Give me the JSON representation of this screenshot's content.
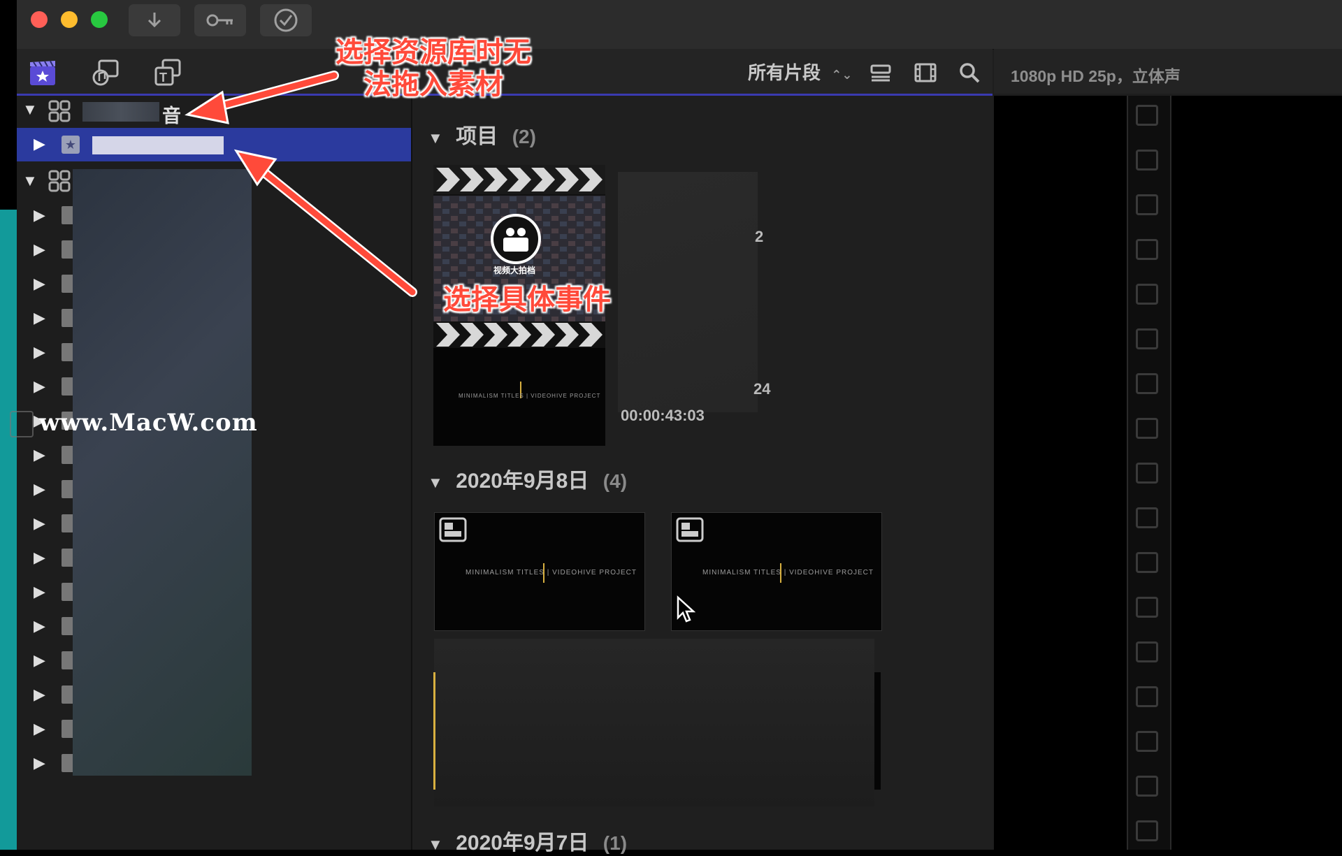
{
  "window": {
    "toolbar_buttons": [
      "download-icon",
      "key-icon",
      "checkmark-circle-icon"
    ]
  },
  "browser_toolbar": {
    "clip_filter_label": "所有片段",
    "icons": [
      "libraries-icon",
      "photos-audio-icon",
      "titles-generators-icon",
      "clip-appearance-icon",
      "filmstrip-icon",
      "search-icon"
    ]
  },
  "viewer": {
    "format_label": "1080p HD 25p，立体声"
  },
  "sidebar": {
    "library_suffix": "音",
    "event_count_visible": 17
  },
  "browser": {
    "projects_section": {
      "title": "项目",
      "count": "(2)"
    },
    "project_thumb_text": "视频大拍档",
    "project_partial_text_1": "2",
    "project_partial_text_2": "24",
    "project_timecode": "00:00:43:03",
    "minimal_title_text": "MINIMALISM TITLES | VIDEOHIVE PROJECT",
    "sections": [
      {
        "title": "2020年9月8日",
        "count": "(4)"
      },
      {
        "title": "2020年9月7日",
        "count": "(1)"
      }
    ]
  },
  "annotations": {
    "library_note_line1": "选择资源库时无",
    "library_note_line2": "法拖入素材",
    "event_note": "选择具体事件",
    "arrow_color": "#ff4a3a"
  },
  "watermark": "www.MacW.com",
  "colors": {
    "selection": "#2b3a9e",
    "accent_line": "#3a3ab0",
    "teal_edge": "#129a9a"
  }
}
